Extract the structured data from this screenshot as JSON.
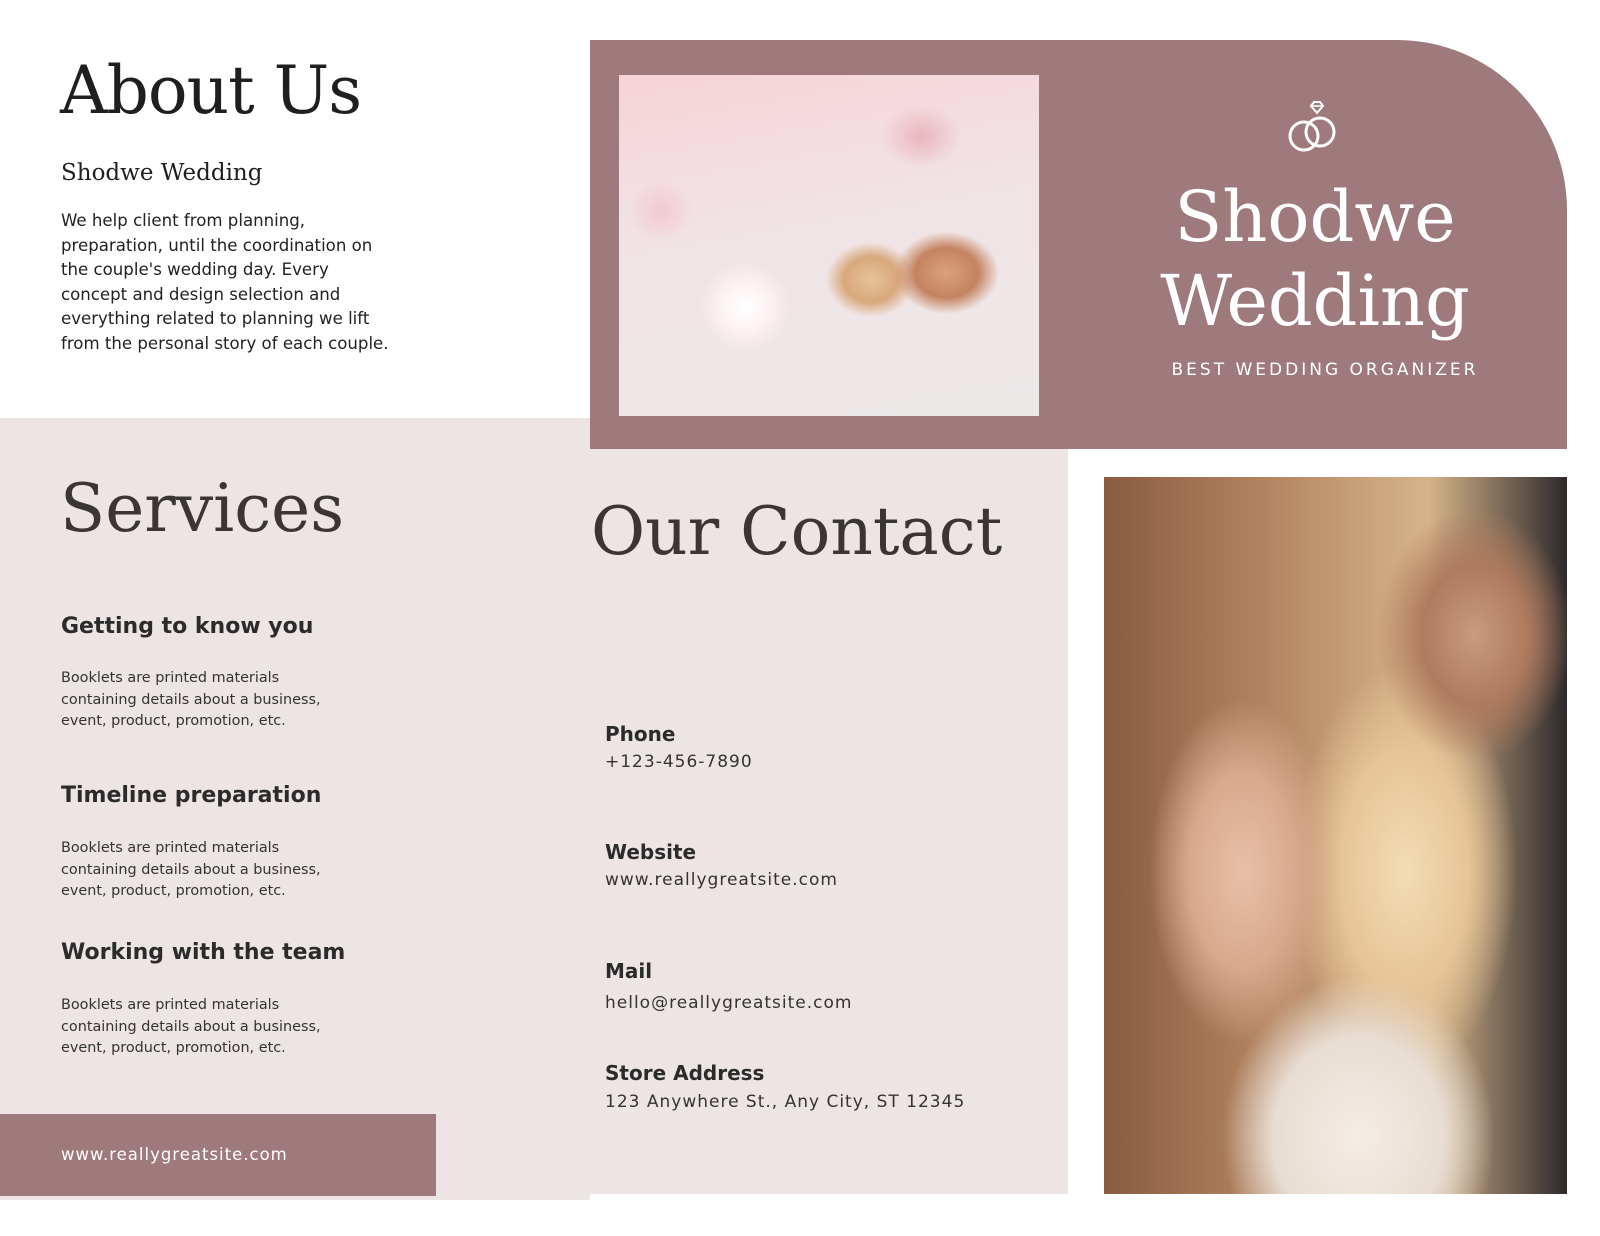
{
  "about": {
    "title": "About Us",
    "subtitle": "Shodwe Wedding",
    "body": "We help client from planning, preparation, until the coordination on the couple's wedding day. Every concept and design selection and everything related to planning we lift from the personal story of each couple."
  },
  "hero": {
    "title": "Shodwe Wedding",
    "tagline": "BEST WEDDING ORGANIZER",
    "icon": "wedding-rings-icon"
  },
  "services": {
    "title": "Services",
    "items": [
      {
        "heading": "Getting to know you",
        "description": "Booklets are printed materials containing details about a business, event, product, promotion, etc."
      },
      {
        "heading": "Timeline preparation",
        "description": "Booklets are printed materials containing details about a business, event, product, promotion, etc."
      },
      {
        "heading": "Working with the team",
        "description": "Booklets are printed materials containing details about a business, event, product, promotion, etc."
      }
    ]
  },
  "contact": {
    "title": "Our Contact",
    "items": [
      {
        "label": "Phone",
        "value": "+123-456-7890"
      },
      {
        "label": "Website",
        "value": "www.reallygreatsite.com"
      },
      {
        "label": "Mail",
        "value": "hello@reallygreatsite.com"
      },
      {
        "label": "Store Address",
        "value": "123 Anywhere St., Any City, ST 12345"
      }
    ]
  },
  "footer": {
    "url": "www.reallygreatsite.com"
  },
  "colors": {
    "mauve": "#9f7a7c",
    "beige": "#ece5e3",
    "white": "#ffffff",
    "text_dark": "#2b2b2b"
  }
}
